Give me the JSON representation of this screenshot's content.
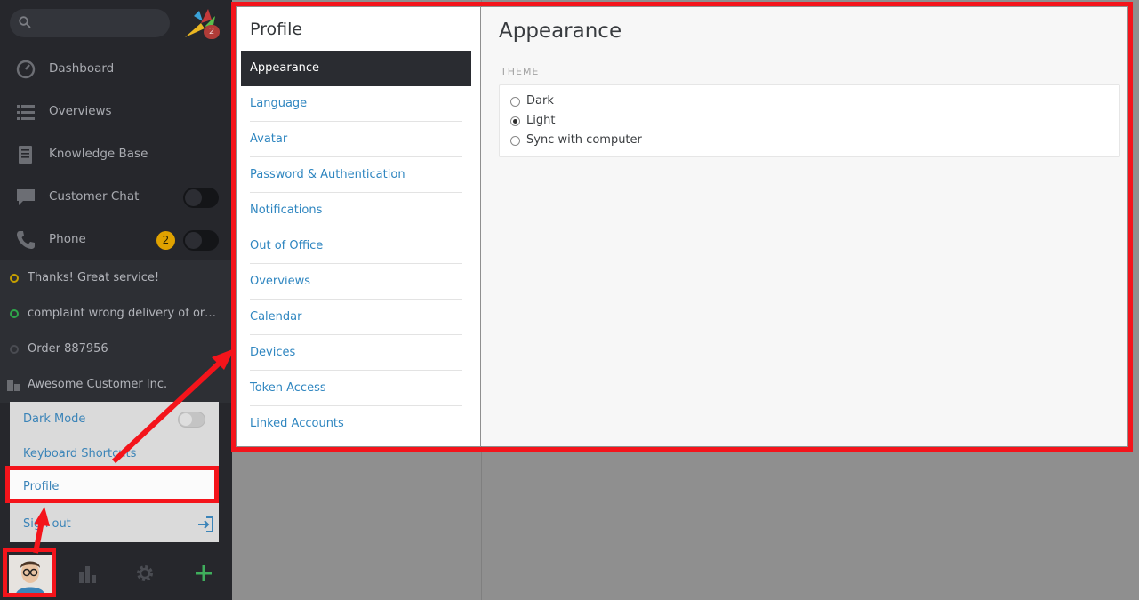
{
  "sidebar": {
    "logo_badge": "2",
    "nav": [
      {
        "label": "Dashboard",
        "icon": "dashboard-icon"
      },
      {
        "label": "Overviews",
        "icon": "list-icon"
      },
      {
        "label": "Knowledge Base",
        "icon": "book-icon"
      },
      {
        "label": "Customer Chat",
        "icon": "chat-icon"
      },
      {
        "label": "Phone",
        "icon": "phone-icon",
        "badge": "2"
      }
    ],
    "recent": [
      {
        "label": "Thanks! Great service!",
        "status_color": "#c6a000"
      },
      {
        "label": "complaint wrong delivery of ord...",
        "status_color": "#2ea84a"
      },
      {
        "label": "Order 887956",
        "status_color": "#4a4c52"
      },
      {
        "label": "Awesome Customer Inc.",
        "status_color": "#6b6d72"
      }
    ],
    "user_menu": {
      "dark_mode": "Dark Mode",
      "keyboard_shortcuts": "Keyboard Shortcuts",
      "profile": "Profile",
      "sign_out": "Sign out"
    }
  },
  "profile": {
    "title": "Profile",
    "items": [
      "Appearance",
      "Language",
      "Avatar",
      "Password & Authentication",
      "Notifications",
      "Out of Office",
      "Overviews",
      "Calendar",
      "Devices",
      "Token Access",
      "Linked Accounts"
    ],
    "active": "Appearance"
  },
  "appearance": {
    "title": "Appearance",
    "theme_label": "THEME",
    "options": [
      "Dark",
      "Light",
      "Sync with computer"
    ],
    "selected": "Light"
  },
  "colors": {
    "accent": "#2f86c0",
    "annotation": "#f4141b",
    "sidebar_bg": "#26272c"
  }
}
